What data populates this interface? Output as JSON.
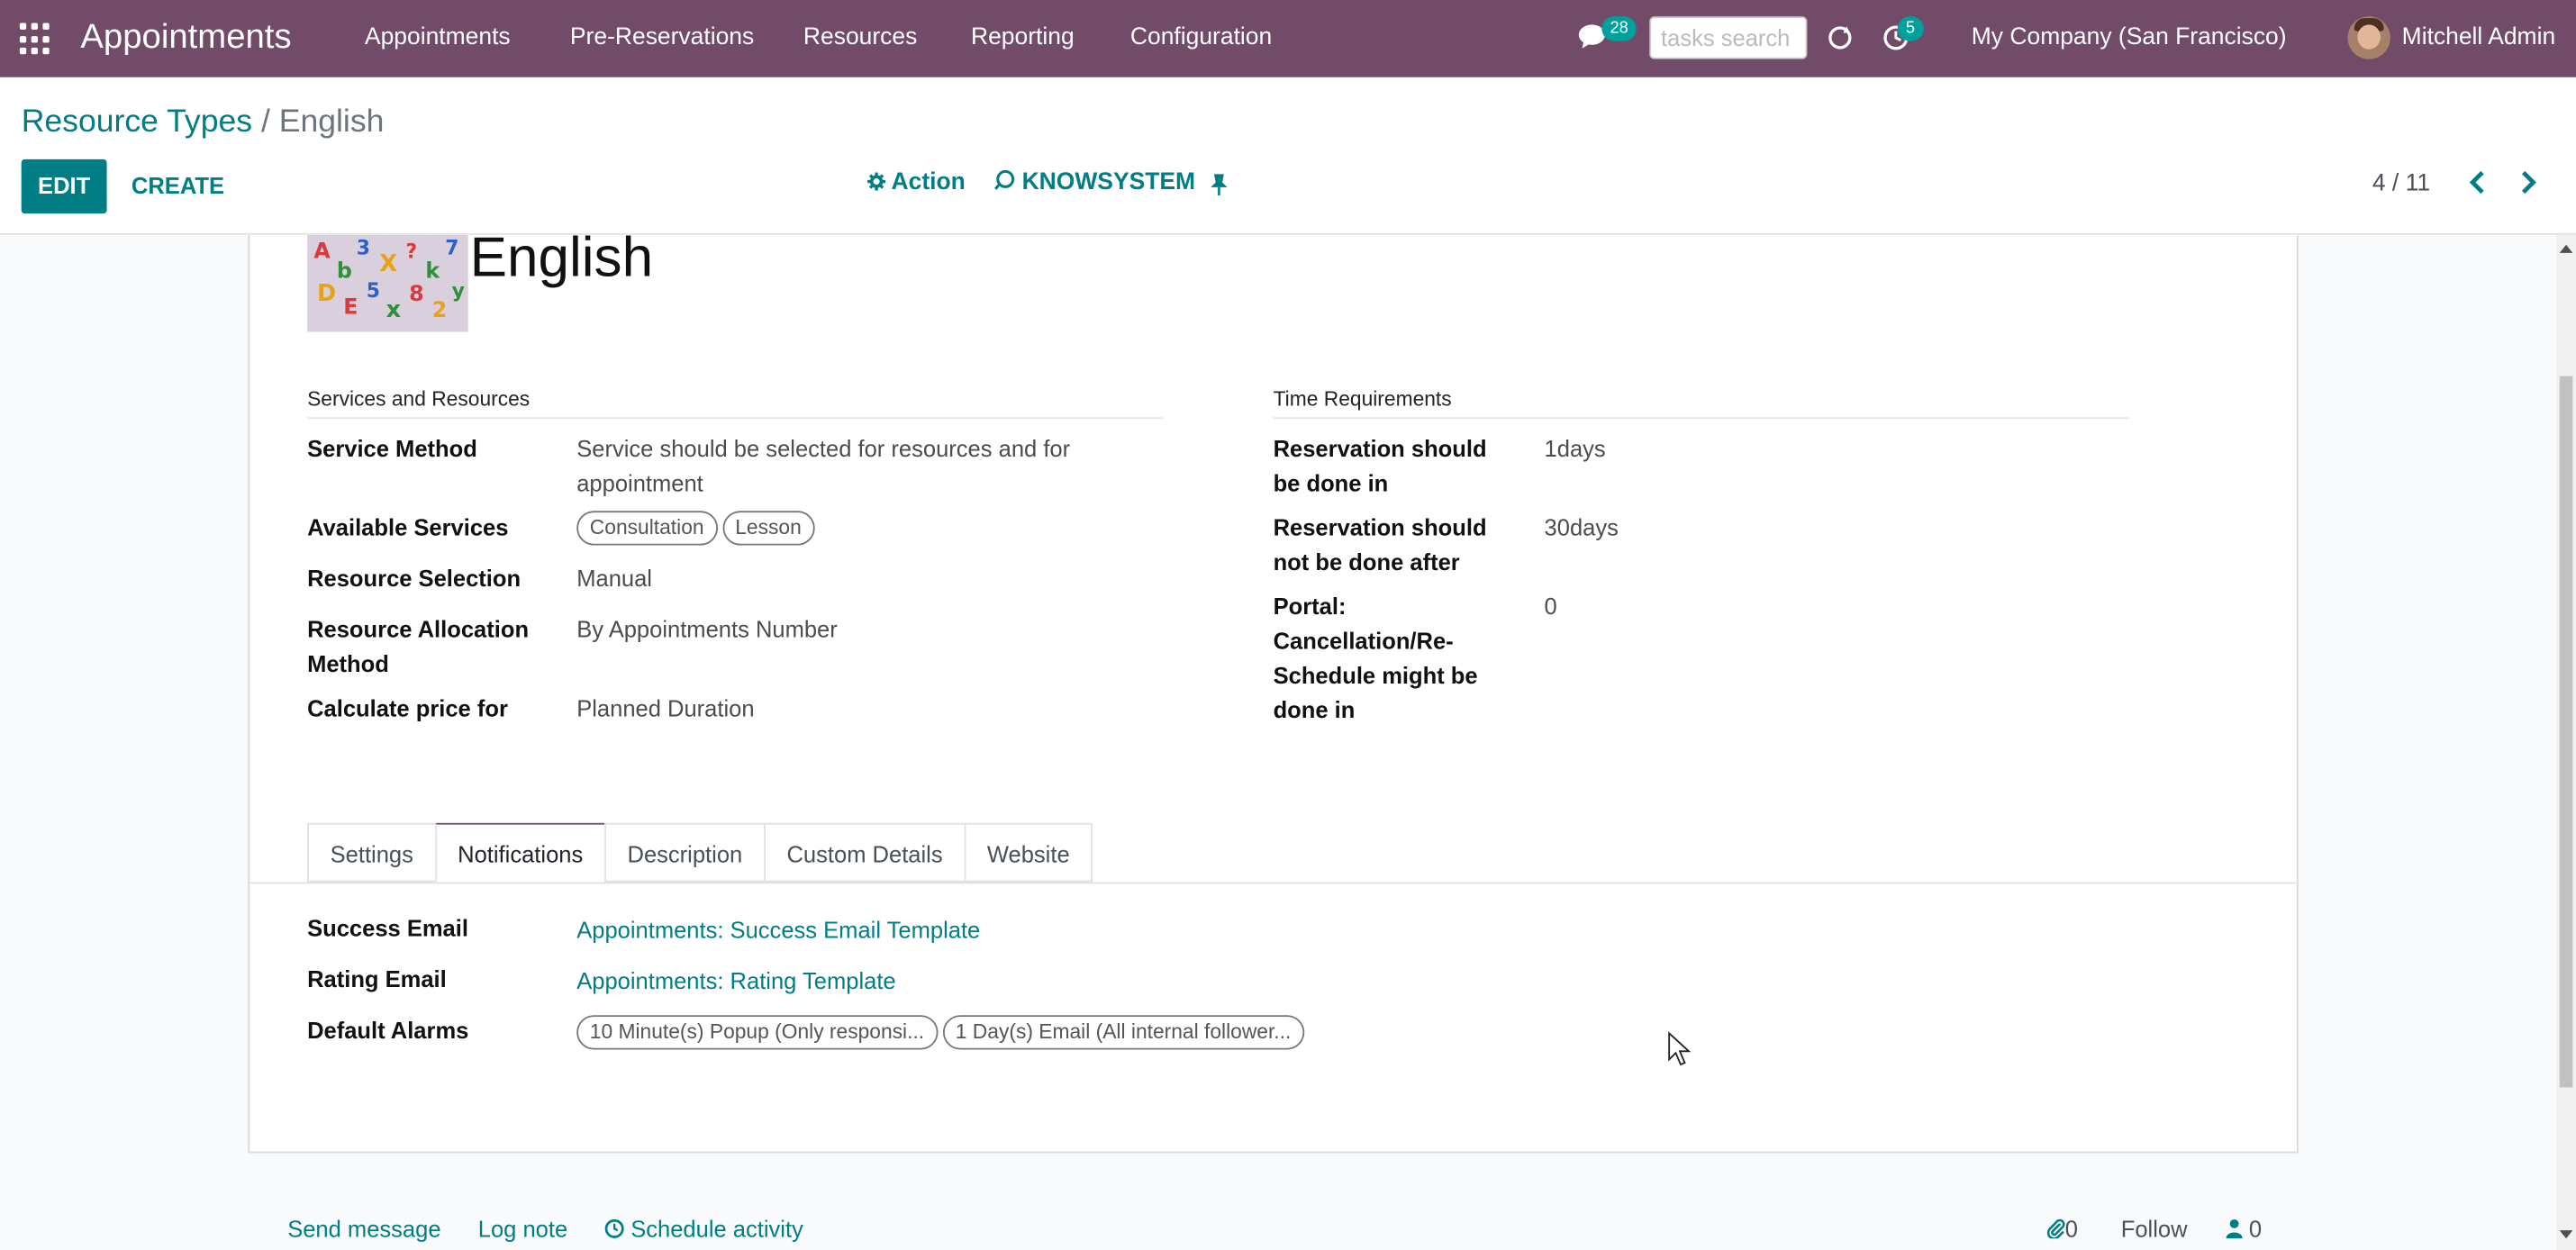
{
  "navbar": {
    "app_name": "Appointments",
    "menu": [
      "Appointments",
      "Pre-Reservations",
      "Resources",
      "Reporting",
      "Configuration"
    ],
    "messages_count": "28",
    "search_placeholder": "tasks search",
    "activities_count": "5",
    "company": "My Company (San Francisco)",
    "user": "Mitchell Admin",
    "icons": [
      "apps-grid-icon",
      "chat-icon",
      "refresh-icon",
      "activity-clock-icon"
    ]
  },
  "breadcrumb": {
    "parent": "Resource Types",
    "separator": "/",
    "current": "English"
  },
  "toolbar": {
    "edit_label": "EDIT",
    "create_label": "CREATE",
    "action_label": "Action",
    "knowsystem_label": "KNOWSYSTEM",
    "pager": "4 / 11"
  },
  "record": {
    "name": "English"
  },
  "services_group": {
    "title": "Services and Resources",
    "fields": [
      {
        "label": "Service Method",
        "value": "Service should be selected for resources and for appointment"
      },
      {
        "label": "Available Services",
        "tags": [
          "Consultation",
          "Lesson"
        ]
      },
      {
        "label": "Resource Selection",
        "value": "Manual"
      },
      {
        "label": "Resource Allocation Method",
        "value": "By Appointments Number"
      },
      {
        "label": "Calculate price for",
        "value": "Planned Duration"
      }
    ]
  },
  "time_group": {
    "title": "Time Requirements",
    "fields": [
      {
        "label": "Reservation should be done in",
        "value": "1days"
      },
      {
        "label": "Reservation should not be done after",
        "value": "30days"
      },
      {
        "label": "Portal: Cancellation/Re-Schedule might be done in",
        "value": "0"
      }
    ]
  },
  "tabs": [
    "Settings",
    "Notifications",
    "Description",
    "Custom Details",
    "Website"
  ],
  "active_tab": "Notifications",
  "notifications": {
    "success_email_label": "Success Email",
    "success_email_value": "Appointments: Success Email Template",
    "rating_email_label": "Rating Email",
    "rating_email_value": "Appointments: Rating Template",
    "default_alarms_label": "Default Alarms",
    "alarms": [
      "10 Minute(s) Popup (Only responsi...",
      "1 Day(s) Email (All internal follower..."
    ]
  },
  "chatter": {
    "send_message": "Send message",
    "log_note": "Log note",
    "schedule_activity": "Schedule activity",
    "attachments_count": "0",
    "follow": "Follow",
    "followers_count": "0"
  },
  "colors": {
    "brand": "#714b67",
    "accent": "#017e84",
    "badge": "#00a09d"
  }
}
